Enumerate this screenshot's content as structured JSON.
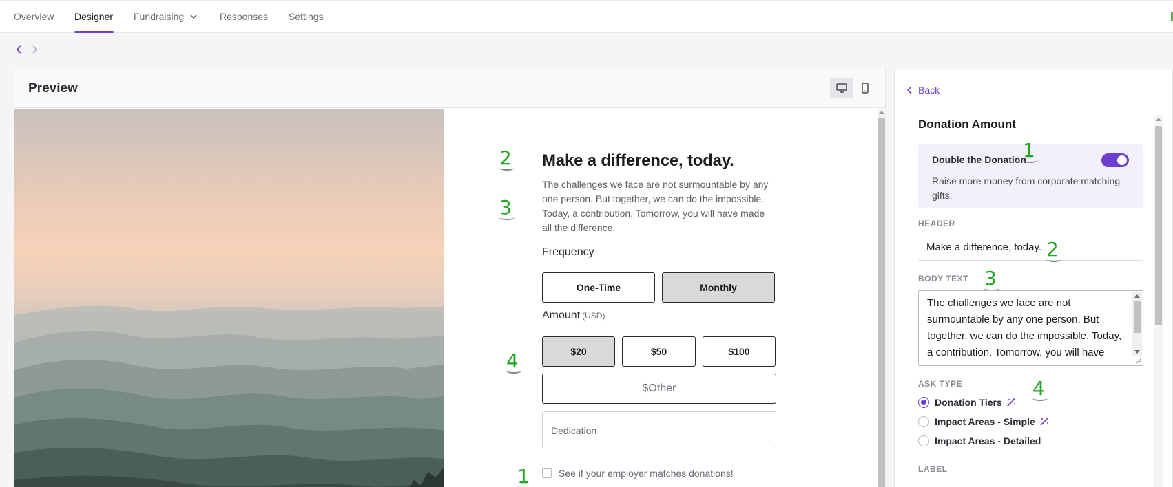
{
  "nav": {
    "tabs": [
      {
        "label": "Overview"
      },
      {
        "label": "Designer"
      },
      {
        "label": "Fundraising"
      },
      {
        "label": "Responses"
      },
      {
        "label": "Settings"
      }
    ],
    "active_tab": "Designer"
  },
  "preview": {
    "title": "Preview",
    "form": {
      "title": "Make a difference, today.",
      "body": "The challenges we face are not surmountable by any one person. But together, we can do the impossible. Today, a contribution. Tomorrow, you will have made all the difference.",
      "frequency_label": "Frequency",
      "frequency_options": [
        "One-Time",
        "Monthly"
      ],
      "frequency_selected": "Monthly",
      "amount_label": "Amount",
      "amount_currency": "(USD)",
      "amount_options": [
        "$20",
        "$50",
        "$100"
      ],
      "amount_selected": "$20",
      "other_placeholder": "$Other",
      "dedication_placeholder": "Dedication",
      "match_label": "See if your employer matches donations!"
    }
  },
  "annotations": {
    "one": "1",
    "two": "2",
    "three": "3",
    "four": "4"
  },
  "side": {
    "back_label": "Back",
    "section_title": "Donation Amount",
    "double": {
      "title": "Double the Donation",
      "desc": "Raise more money from corporate matching gifts.",
      "enabled": true
    },
    "header_caption": "HEADER",
    "header_value": "Make a difference, today.",
    "body_caption": "BODY TEXT",
    "body_value": "The challenges we face are not surmountable by any one person. But together, we can do the impossible. Today, a contribution. Tomorrow, you will have made all the difference.",
    "ask_caption": "ASK TYPE",
    "ask_options": [
      {
        "label": "Donation Tiers",
        "selected": true,
        "icon": "magic-wand-icon"
      },
      {
        "label": "Impact Areas - Simple",
        "selected": false,
        "icon": "magic-wand-icon"
      },
      {
        "label": "Impact Areas - Detailed",
        "selected": false
      }
    ],
    "label_caption": "LABEL"
  },
  "colors": {
    "accent": "#6c3fd1",
    "annotation": "#1fa51f",
    "selected_button": "#d9d9d9",
    "double_bg": "#f4effd"
  }
}
